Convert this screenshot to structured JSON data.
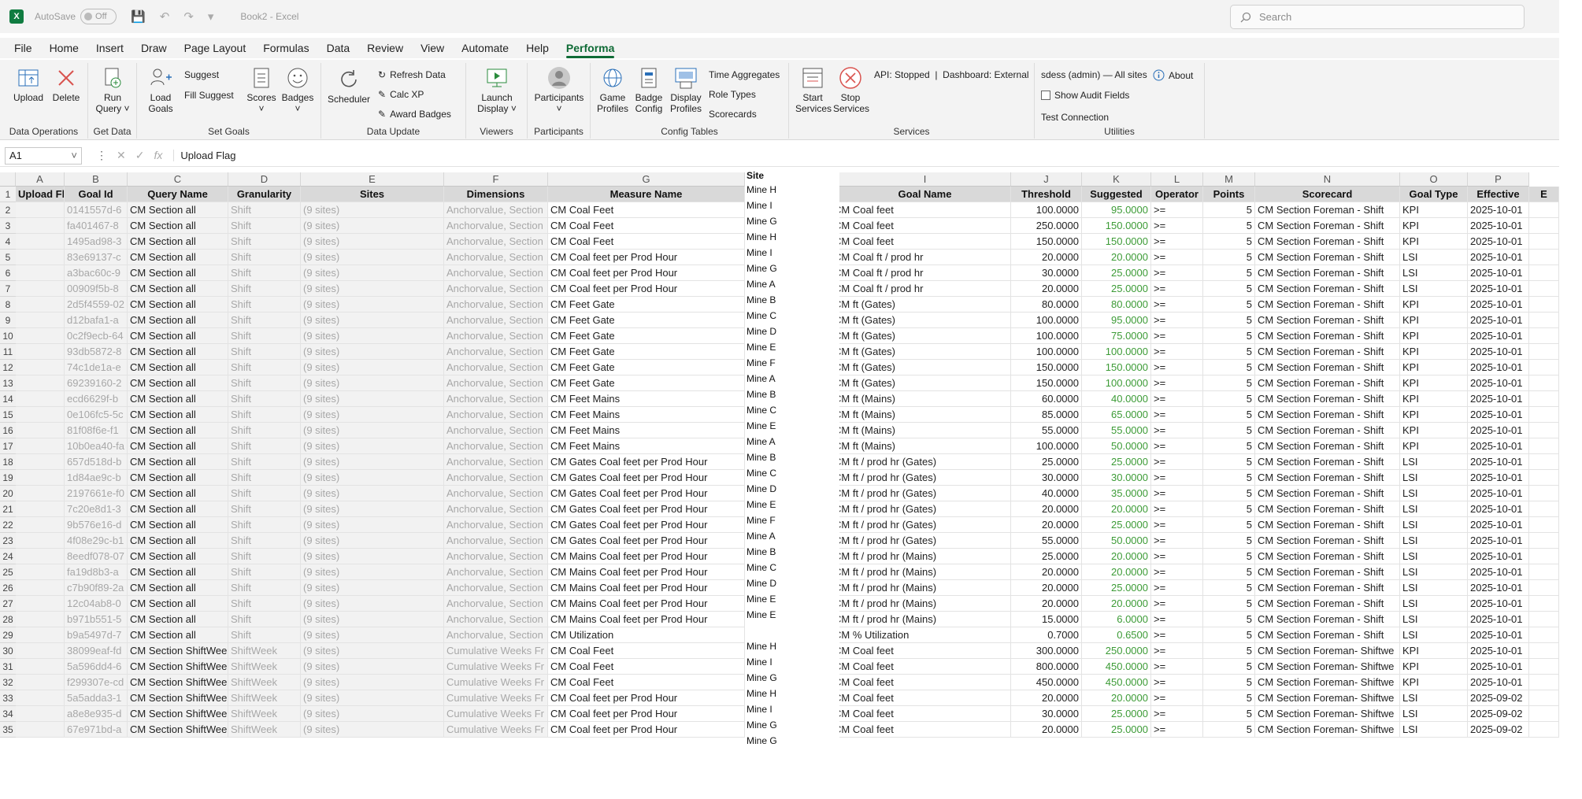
{
  "window": {
    "autosave_label": "AutoSave",
    "autosave_state": "Off",
    "title": "Book2 - Excel",
    "search_placeholder": "Search",
    "logo_letter": "X"
  },
  "menu": [
    "File",
    "Home",
    "Insert",
    "Draw",
    "Page Layout",
    "Formulas",
    "Data",
    "Review",
    "View",
    "Automate",
    "Help",
    "Performa"
  ],
  "ribbon": {
    "data_operations": {
      "label": "Data Operations",
      "upload": "Upload",
      "delete": "Delete"
    },
    "get_data": {
      "label": "Get Data",
      "run_query": "Run Query ˅"
    },
    "set_goals": {
      "label": "Set Goals",
      "load_goals": "Load Goals",
      "suggest": "Suggest",
      "fill_suggest": "Fill Suggest",
      "scores": "Scores",
      "badges": "Badges"
    },
    "data_update": {
      "label": "Data Update",
      "scheduler": "Scheduler",
      "refresh_data": "Refresh Data",
      "calc_xp": "Calc XP",
      "award_badges": "Award Badges"
    },
    "viewers": {
      "label": "Viewers",
      "launch_display": "Launch Display ˅"
    },
    "participants": {
      "label": "Participants",
      "participants": "Participants"
    },
    "config_tables": {
      "label": "Config Tables",
      "game_profiles": "Game Profiles",
      "badge_config": "Badge Config",
      "display_profiles": "Display Profiles",
      "time_aggregates": "Time Aggregates",
      "role_types": "Role Types",
      "scorecards": "Scorecards"
    },
    "services": {
      "label": "Services",
      "start": "Start Services",
      "stop": "Stop Services",
      "status": "API: Stopped  |  Dashboard: External"
    },
    "utilities": {
      "label": "Utilities",
      "user": "sdess (admin) — All sites",
      "about": "About",
      "audit": "Show Audit Fields",
      "test_connection": "Test Connection"
    }
  },
  "formula_bar": {
    "name_box": "A1",
    "content": "Upload Flag"
  },
  "columns": [
    "A",
    "B",
    "C",
    "D",
    "E",
    "F",
    "G",
    "I",
    "J",
    "K",
    "L",
    "M",
    "N",
    "O",
    "P"
  ],
  "headers": {
    "A": "Upload Flag",
    "B": "Goal Id",
    "C": "Query Name",
    "D": "Granularity",
    "E": "Sites",
    "F": "Dimensions",
    "G": "Measure Name",
    "site": "Site",
    "I": "Goal Name",
    "J": "Threshold",
    "K": "Suggested",
    "L": "Operator",
    "M": "Points",
    "N": "Scorecard",
    "O": "Goal Type",
    "P": "Effective",
    "Q": "E"
  },
  "site_list": [
    "Mine H",
    "Mine I",
    "Mine G",
    "Mine H",
    "Mine I",
    "Mine G",
    "Mine A",
    "Mine B",
    "Mine C",
    "Mine D",
    "Mine E",
    "Mine F",
    "Mine A",
    "Mine B",
    "Mine C",
    "Mine E",
    "Mine A",
    "Mine B",
    "Mine C",
    "Mine D",
    "Mine E",
    "Mine F",
    "Mine A",
    "Mine B",
    "Mine C",
    "Mine D",
    "Mine E",
    "Mine E",
    "",
    "Mine H",
    "Mine I",
    "Mine G",
    "Mine H",
    "Mine I",
    "Mine G",
    "Mine G"
  ],
  "rows": [
    {
      "n": "2",
      "B": "0141557d-6",
      "C": "CM Section all",
      "D": "Shift",
      "E": "(9 sites)",
      "F": "Anchorvalue, Section",
      "G": "CM Coal Feet",
      "I": "CM Coal feet",
      "J": "100.0000",
      "K": "95.0000",
      "L": ">=",
      "M": "5",
      "N": "CM Section Foreman - Shift",
      "O": "KPI",
      "P": "2025-10-01"
    },
    {
      "n": "3",
      "B": "fa401467-8",
      "C": "CM Section all",
      "D": "Shift",
      "E": "(9 sites)",
      "F": "Anchorvalue, Section",
      "G": "CM Coal Feet",
      "I": "CM Coal feet",
      "J": "250.0000",
      "K": "150.0000",
      "L": ">=",
      "M": "5",
      "N": "CM Section Foreman - Shift",
      "O": "KPI",
      "P": "2025-10-01"
    },
    {
      "n": "4",
      "B": "1495ad98-3",
      "C": "CM Section all",
      "D": "Shift",
      "E": "(9 sites)",
      "F": "Anchorvalue, Section",
      "G": "CM Coal Feet",
      "I": "CM Coal feet",
      "J": "150.0000",
      "K": "150.0000",
      "L": ">=",
      "M": "5",
      "N": "CM Section Foreman - Shift",
      "O": "KPI",
      "P": "2025-10-01"
    },
    {
      "n": "5",
      "B": "83e69137-c",
      "C": "CM Section all",
      "D": "Shift",
      "E": "(9 sites)",
      "F": "Anchorvalue, Section",
      "G": "CM Coal feet per Prod Hour",
      "I": "CM Coal ft / prod hr",
      "J": "20.0000",
      "K": "20.0000",
      "L": ">=",
      "M": "5",
      "N": "CM Section Foreman - Shift",
      "O": "LSI",
      "P": "2025-10-01"
    },
    {
      "n": "6",
      "B": "a3bac60c-9",
      "C": "CM Section all",
      "D": "Shift",
      "E": "(9 sites)",
      "F": "Anchorvalue, Section",
      "G": "CM Coal feet per Prod Hour",
      "I": "CM Coal ft / prod hr",
      "J": "30.0000",
      "K": "25.0000",
      "L": ">=",
      "M": "5",
      "N": "CM Section Foreman - Shift",
      "O": "LSI",
      "P": "2025-10-01"
    },
    {
      "n": "7",
      "B": "00909f5b-8",
      "C": "CM Section all",
      "D": "Shift",
      "E": "(9 sites)",
      "F": "Anchorvalue, Section",
      "G": "CM Coal feet per Prod Hour",
      "I": "CM Coal ft / prod hr",
      "J": "20.0000",
      "K": "25.0000",
      "L": ">=",
      "M": "5",
      "N": "CM Section Foreman - Shift",
      "O": "LSI",
      "P": "2025-10-01"
    },
    {
      "n": "8",
      "B": "2d5f4559-02",
      "C": "CM Section all",
      "D": "Shift",
      "E": "(9 sites)",
      "F": "Anchorvalue, Section",
      "G": "CM Feet Gate",
      "I": "CM ft (Gates)",
      "J": "80.0000",
      "K": "80.0000",
      "L": ">=",
      "M": "5",
      "N": "CM Section Foreman - Shift",
      "O": "KPI",
      "P": "2025-10-01"
    },
    {
      "n": "9",
      "B": "d12bafa1-a",
      "C": "CM Section all",
      "D": "Shift",
      "E": "(9 sites)",
      "F": "Anchorvalue, Section",
      "G": "CM Feet Gate",
      "I": "CM ft (Gates)",
      "J": "100.0000",
      "K": "95.0000",
      "L": ">=",
      "M": "5",
      "N": "CM Section Foreman - Shift",
      "O": "KPI",
      "P": "2025-10-01"
    },
    {
      "n": "10",
      "B": "0c2f9ecb-64",
      "C": "CM Section all",
      "D": "Shift",
      "E": "(9 sites)",
      "F": "Anchorvalue, Section",
      "G": "CM Feet Gate",
      "I": "CM ft (Gates)",
      "J": "100.0000",
      "K": "75.0000",
      "L": ">=",
      "M": "5",
      "N": "CM Section Foreman - Shift",
      "O": "KPI",
      "P": "2025-10-01"
    },
    {
      "n": "11",
      "B": "93db5872-8",
      "C": "CM Section all",
      "D": "Shift",
      "E": "(9 sites)",
      "F": "Anchorvalue, Section",
      "G": "CM Feet Gate",
      "I": "CM ft (Gates)",
      "J": "100.0000",
      "K": "100.0000",
      "L": ">=",
      "M": "5",
      "N": "CM Section Foreman - Shift",
      "O": "KPI",
      "P": "2025-10-01"
    },
    {
      "n": "12",
      "B": "74c1de1a-e",
      "C": "CM Section all",
      "D": "Shift",
      "E": "(9 sites)",
      "F": "Anchorvalue, Section",
      "G": "CM Feet Gate",
      "I": "CM ft (Gates)",
      "J": "150.0000",
      "K": "150.0000",
      "L": ">=",
      "M": "5",
      "N": "CM Section Foreman - Shift",
      "O": "KPI",
      "P": "2025-10-01"
    },
    {
      "n": "13",
      "B": "69239160-2",
      "C": "CM Section all",
      "D": "Shift",
      "E": "(9 sites)",
      "F": "Anchorvalue, Section",
      "G": "CM Feet Gate",
      "I": "CM ft (Gates)",
      "J": "150.0000",
      "K": "100.0000",
      "L": ">=",
      "M": "5",
      "N": "CM Section Foreman - Shift",
      "O": "KPI",
      "P": "2025-10-01"
    },
    {
      "n": "14",
      "B": "ecd6629f-b",
      "C": "CM Section all",
      "D": "Shift",
      "E": "(9 sites)",
      "F": "Anchorvalue, Section",
      "G": "CM Feet Mains",
      "I": "CM ft (Mains)",
      "J": "60.0000",
      "K": "40.0000",
      "L": ">=",
      "M": "5",
      "N": "CM Section Foreman - Shift",
      "O": "KPI",
      "P": "2025-10-01"
    },
    {
      "n": "15",
      "B": "0e106fc5-5c",
      "C": "CM Section all",
      "D": "Shift",
      "E": "(9 sites)",
      "F": "Anchorvalue, Section",
      "G": "CM Feet Mains",
      "I": "CM ft (Mains)",
      "J": "85.0000",
      "K": "65.0000",
      "L": ">=",
      "M": "5",
      "N": "CM Section Foreman - Shift",
      "O": "KPI",
      "P": "2025-10-01"
    },
    {
      "n": "16",
      "B": "81f08f6e-f1",
      "C": "CM Section all",
      "D": "Shift",
      "E": "(9 sites)",
      "F": "Anchorvalue, Section",
      "G": "CM Feet Mains",
      "I": "CM ft (Mains)",
      "J": "55.0000",
      "K": "55.0000",
      "L": ">=",
      "M": "5",
      "N": "CM Section Foreman - Shift",
      "O": "KPI",
      "P": "2025-10-01"
    },
    {
      "n": "17",
      "B": "10b0ea40-fa",
      "C": "CM Section all",
      "D": "Shift",
      "E": "(9 sites)",
      "F": "Anchorvalue, Section",
      "G": "CM Feet Mains",
      "I": "CM ft (Mains)",
      "J": "100.0000",
      "K": "50.0000",
      "L": ">=",
      "M": "5",
      "N": "CM Section Foreman - Shift",
      "O": "KPI",
      "P": "2025-10-01"
    },
    {
      "n": "18",
      "B": "657d518d-b",
      "C": "CM Section all",
      "D": "Shift",
      "E": "(9 sites)",
      "F": "Anchorvalue, Section",
      "G": "CM Gates Coal feet per Prod Hour",
      "I": "CM ft / prod hr (Gates)",
      "J": "25.0000",
      "K": "25.0000",
      "L": ">=",
      "M": "5",
      "N": "CM Section Foreman - Shift",
      "O": "LSI",
      "P": "2025-10-01"
    },
    {
      "n": "19",
      "B": "1d84ae9c-b",
      "C": "CM Section all",
      "D": "Shift",
      "E": "(9 sites)",
      "F": "Anchorvalue, Section",
      "G": "CM Gates Coal feet per Prod Hour",
      "I": "CM ft / prod hr (Gates)",
      "J": "30.0000",
      "K": "30.0000",
      "L": ">=",
      "M": "5",
      "N": "CM Section Foreman - Shift",
      "O": "LSI",
      "P": "2025-10-01"
    },
    {
      "n": "20",
      "B": "2197661e-f0",
      "C": "CM Section all",
      "D": "Shift",
      "E": "(9 sites)",
      "F": "Anchorvalue, Section",
      "G": "CM Gates Coal feet per Prod Hour",
      "I": "CM ft / prod hr (Gates)",
      "J": "40.0000",
      "K": "35.0000",
      "L": ">=",
      "M": "5",
      "N": "CM Section Foreman - Shift",
      "O": "LSI",
      "P": "2025-10-01"
    },
    {
      "n": "21",
      "B": "7c20e8d1-3",
      "C": "CM Section all",
      "D": "Shift",
      "E": "(9 sites)",
      "F": "Anchorvalue, Section",
      "G": "CM Gates Coal feet per Prod Hour",
      "I": "CM ft / prod hr (Gates)",
      "J": "20.0000",
      "K": "20.0000",
      "L": ">=",
      "M": "5",
      "N": "CM Section Foreman - Shift",
      "O": "LSI",
      "P": "2025-10-01"
    },
    {
      "n": "22",
      "B": "9b576e16-d",
      "C": "CM Section all",
      "D": "Shift",
      "E": "(9 sites)",
      "F": "Anchorvalue, Section",
      "G": "CM Gates Coal feet per Prod Hour",
      "I": "CM ft / prod hr (Gates)",
      "J": "20.0000",
      "K": "25.0000",
      "L": ">=",
      "M": "5",
      "N": "CM Section Foreman - Shift",
      "O": "LSI",
      "P": "2025-10-01"
    },
    {
      "n": "23",
      "B": "4f08e29c-b1",
      "C": "CM Section all",
      "D": "Shift",
      "E": "(9 sites)",
      "F": "Anchorvalue, Section",
      "G": "CM Gates Coal feet per Prod Hour",
      "I": "CM ft / prod hr (Gates)",
      "J": "55.0000",
      "K": "50.0000",
      "L": ">=",
      "M": "5",
      "N": "CM Section Foreman - Shift",
      "O": "LSI",
      "P": "2025-10-01"
    },
    {
      "n": "24",
      "B": "8eedf078-07",
      "C": "CM Section all",
      "D": "Shift",
      "E": "(9 sites)",
      "F": "Anchorvalue, Section",
      "G": "CM Mains Coal feet per Prod Hour",
      "I": "CM ft / prod hr (Mains)",
      "J": "25.0000",
      "K": "20.0000",
      "L": ">=",
      "M": "5",
      "N": "CM Section Foreman - Shift",
      "O": "LSI",
      "P": "2025-10-01"
    },
    {
      "n": "25",
      "B": "fa19d8b3-a",
      "C": "CM Section all",
      "D": "Shift",
      "E": "(9 sites)",
      "F": "Anchorvalue, Section",
      "G": "CM Mains Coal feet per Prod Hour",
      "I": "CM ft / prod hr (Mains)",
      "J": "20.0000",
      "K": "20.0000",
      "L": ">=",
      "M": "5",
      "N": "CM Section Foreman - Shift",
      "O": "LSI",
      "P": "2025-10-01"
    },
    {
      "n": "26",
      "B": "c7b90f89-2a",
      "C": "CM Section all",
      "D": "Shift",
      "E": "(9 sites)",
      "F": "Anchorvalue, Section",
      "G": "CM Mains Coal feet per Prod Hour",
      "I": "CM ft / prod hr (Mains)",
      "J": "20.0000",
      "K": "25.0000",
      "L": ">=",
      "M": "5",
      "N": "CM Section Foreman - Shift",
      "O": "LSI",
      "P": "2025-10-01"
    },
    {
      "n": "27",
      "B": "12c04ab8-0",
      "C": "CM Section all",
      "D": "Shift",
      "E": "(9 sites)",
      "F": "Anchorvalue, Section",
      "G": "CM Mains Coal feet per Prod Hour",
      "I": "CM ft / prod hr (Mains)",
      "J": "20.0000",
      "K": "20.0000",
      "L": ">=",
      "M": "5",
      "N": "CM Section Foreman - Shift",
      "O": "LSI",
      "P": "2025-10-01"
    },
    {
      "n": "28",
      "B": "b971b551-5",
      "C": "CM Section all",
      "D": "Shift",
      "E": "(9 sites)",
      "F": "Anchorvalue, Section",
      "G": "CM Mains Coal feet per Prod Hour",
      "I": "CM ft / prod hr (Mains)",
      "J": "15.0000",
      "K": "6.0000",
      "L": ">=",
      "M": "5",
      "N": "CM Section Foreman - Shift",
      "O": "LSI",
      "P": "2025-10-01"
    },
    {
      "n": "29",
      "B": "b9a5497d-7",
      "C": "CM Section all",
      "D": "Shift",
      "E": "(9 sites)",
      "F": "Anchorvalue, Section",
      "G": "CM Utilization",
      "I": "CM % Utilization",
      "J": "0.7000",
      "K": "0.6500",
      "L": ">=",
      "M": "5",
      "N": "CM Section Foreman - Shift",
      "O": "LSI",
      "P": "2025-10-01"
    },
    {
      "n": "30",
      "B": "38099eaf-fd",
      "C": "CM Section ShiftWeek",
      "D": "ShiftWeek",
      "E": "(9 sites)",
      "F": "Cumulative Weeks Fr",
      "G": "CM Coal Feet",
      "I": "CM Coal feet",
      "J": "300.0000",
      "K": "250.0000",
      "L": ">=",
      "M": "5",
      "N": "CM Section Foreman- Shiftwe",
      "O": "KPI",
      "P": "2025-10-01"
    },
    {
      "n": "31",
      "B": "5a596dd4-6",
      "C": "CM Section ShiftWeek",
      "D": "ShiftWeek",
      "E": "(9 sites)",
      "F": "Cumulative Weeks Fr",
      "G": "CM Coal Feet",
      "I": "CM Coal feet",
      "J": "800.0000",
      "K": "450.0000",
      "L": ">=",
      "M": "5",
      "N": "CM Section Foreman- Shiftwe",
      "O": "KPI",
      "P": "2025-10-01"
    },
    {
      "n": "32",
      "B": "f299307e-cd",
      "C": "CM Section ShiftWeek",
      "D": "ShiftWeek",
      "E": "(9 sites)",
      "F": "Cumulative Weeks Fr",
      "G": "CM Coal Feet",
      "I": "CM Coal feet",
      "J": "450.0000",
      "K": "450.0000",
      "L": ">=",
      "M": "5",
      "N": "CM Section Foreman- Shiftwe",
      "O": "KPI",
      "P": "2025-10-01"
    },
    {
      "n": "33",
      "B": "5a5adda3-1",
      "C": "CM Section ShiftWeek",
      "D": "ShiftWeek",
      "E": "(9 sites)",
      "F": "Cumulative Weeks Fr",
      "G": "CM Coal feet per Prod Hour",
      "I": "CM Coal feet",
      "J": "20.0000",
      "K": "20.0000",
      "L": ">=",
      "M": "5",
      "N": "CM Section Foreman- Shiftwe",
      "O": "LSI",
      "P": "2025-09-02"
    },
    {
      "n": "34",
      "B": "a8e8e935-d",
      "C": "CM Section ShiftWeek",
      "D": "ShiftWeek",
      "E": "(9 sites)",
      "F": "Cumulative Weeks Fr",
      "G": "CM Coal feet per Prod Hour",
      "I": "CM Coal feet",
      "J": "30.0000",
      "K": "25.0000",
      "L": ">=",
      "M": "5",
      "N": "CM Section Foreman- Shiftwe",
      "O": "LSI",
      "P": "2025-09-02"
    },
    {
      "n": "35",
      "B": "67e971bd-a",
      "C": "CM Section ShiftWeek",
      "D": "ShiftWeek",
      "E": "(9 sites)",
      "F": "Cumulative Weeks Fr",
      "G": "CM Coal feet per Prod Hour",
      "I": "CM Coal feet",
      "J": "20.0000",
      "K": "25.0000",
      "L": ">=",
      "M": "5",
      "N": "CM Section Foreman- Shiftwe",
      "O": "LSI",
      "P": "2025-09-02"
    }
  ]
}
